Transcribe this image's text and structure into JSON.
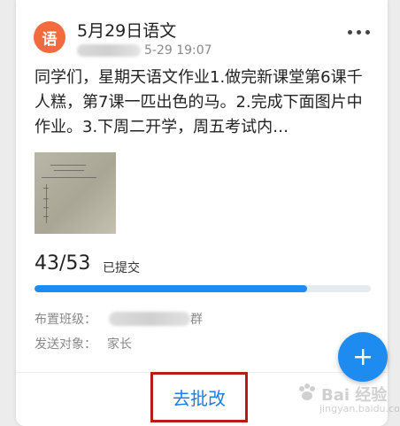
{
  "post": {
    "avatar_char": "语",
    "title": "5月29日语文",
    "time": "5-29 19:07",
    "body": "同学们，星期天语文作业1.做完新课堂第6课千人糕，第7课一匹出色的马。2.完成下面图片中作业。3.下周二开学，周五考试内…"
  },
  "submission": {
    "count": "43/53",
    "label": "已提交",
    "progress_fraction": 0.81
  },
  "meta": {
    "class_label": "布置班级：",
    "class_value_suffix": "群",
    "target_label": "发送对象：",
    "target_value": "家长"
  },
  "action": {
    "label": "去批改"
  },
  "icons": {
    "more": "more-dots-icon",
    "fab": "plus-icon",
    "watermark": "baidu-paw-icon"
  },
  "watermark": {
    "text": "Bai 经验",
    "sub": "jingyan.baidu.com"
  },
  "colors": {
    "accent": "#1e8bf0",
    "avatar": "#f26a3d",
    "highlight_box": "#b71c1c",
    "action_text": "#1e7ee8"
  }
}
